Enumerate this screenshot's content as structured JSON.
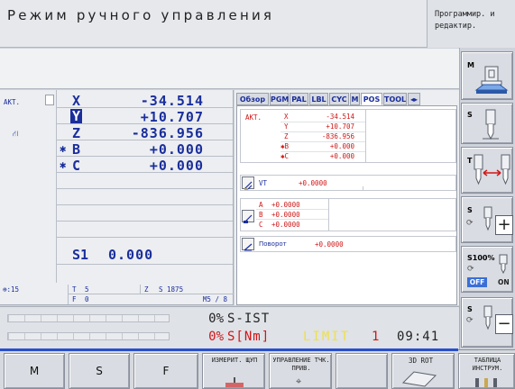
{
  "header": {
    "mode_title": "Режим ручного управления",
    "side_mode": "Программир. и редактир."
  },
  "pos_display": {
    "akt_label": "AKT.",
    "axes": [
      {
        "label": "X",
        "value": "-34.514"
      },
      {
        "label": "Y",
        "value": "+10.707"
      },
      {
        "label": "Z",
        "value": "-836.956"
      },
      {
        "label": "B",
        "value": "+0.000",
        "prefix": "✱"
      },
      {
        "label": "C",
        "value": "+0.000",
        "prefix": "✱"
      }
    ],
    "spindle": {
      "label": "S1",
      "value": "0.000"
    }
  },
  "status_bar": {
    "feed_icon_value": ":15",
    "t_label": "T",
    "t_value": "5",
    "z_label": "Z",
    "z_value": "S 1875",
    "f_label": "F",
    "f_value": "0",
    "m_value": "M5 / 8"
  },
  "tabs": [
    {
      "label": "Обзор",
      "active": false
    },
    {
      "label": "PGM",
      "active": false
    },
    {
      "label": "PAL",
      "active": false
    },
    {
      "label": "LBL",
      "active": false
    },
    {
      "label": "CYC",
      "active": false
    },
    {
      "label": "M",
      "active": false
    },
    {
      "label": "POS",
      "active": true
    },
    {
      "label": "TOOL",
      "active": false
    }
  ],
  "pos_tab": {
    "akt_label": "AKT.",
    "rows": [
      {
        "axis": "X",
        "value": "-34.514"
      },
      {
        "axis": "Y",
        "value": "+10.707"
      },
      {
        "axis": "Z",
        "value": "-836.956"
      },
      {
        "axis": "✱B",
        "value": "+0.000"
      },
      {
        "axis": "✱C",
        "value": "+0.000"
      }
    ],
    "vt_label": "VT",
    "vt_value": "+0.0000",
    "abc_rows": [
      {
        "axis": "A",
        "value": "+0.0000"
      },
      {
        "axis": "B",
        "value": "+0.0000"
      },
      {
        "axis": "C",
        "value": "+0.0000"
      }
    ],
    "rotation_label": "Поворот",
    "rotation_value": "+0.0000"
  },
  "overrides": {
    "line1_pct": "0%",
    "line1_label": "S-IST",
    "line2_pct": "0%",
    "line2_label": "S[Nm]",
    "limit_label": "LIMIT",
    "limit_value": "1",
    "clock": "09:41"
  },
  "right_panel": {
    "m_label": "M",
    "s_label": "S",
    "t_label": "T",
    "s_plus_label": "S",
    "override_pct": "S100%",
    "off_label": "OFF",
    "on_label": "ON",
    "s_minus_label": "S"
  },
  "softkeys": [
    {
      "label": "M"
    },
    {
      "label": "S"
    },
    {
      "label": "F"
    },
    {
      "label": "ИЗМЕРИТ. ЩУП"
    },
    {
      "label": "УПРАВЛЕНИЕ ТЧК. ПРИВ."
    },
    {
      "label": ""
    },
    {
      "label": "3D ROT"
    },
    {
      "label": "ТАБЛИЦА ИНСТРУМ."
    }
  ],
  "colors": {
    "accent_blue": "#1a2e9c",
    "status_red": "#d01616",
    "limit_yellow": "#f0e04a",
    "softkey_indicator": "#2850c8"
  }
}
